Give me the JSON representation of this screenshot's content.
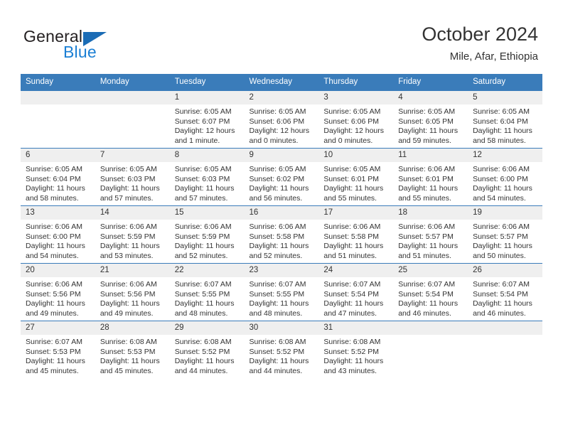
{
  "brand": {
    "name_dark": "General",
    "name_blue": "Blue",
    "accent_blue": "#1b7fd4",
    "header_blue": "#3a7cba"
  },
  "header": {
    "title": "October 2024",
    "subtitle": "Mile, Afar, Ethiopia"
  },
  "weekday_headers": [
    "Sunday",
    "Monday",
    "Tuesday",
    "Wednesday",
    "Thursday",
    "Friday",
    "Saturday"
  ],
  "labels": {
    "sunrise": "Sunrise:",
    "sunset": "Sunset:",
    "daylight": "Daylight:"
  },
  "weeks": [
    [
      {
        "day": "",
        "sunrise": "",
        "sunset": "",
        "daylight_1": "",
        "daylight_2": ""
      },
      {
        "day": "",
        "sunrise": "",
        "sunset": "",
        "daylight_1": "",
        "daylight_2": ""
      },
      {
        "day": "1",
        "sunrise": "Sunrise: 6:05 AM",
        "sunset": "Sunset: 6:07 PM",
        "daylight_1": "Daylight: 12 hours",
        "daylight_2": "and 1 minute."
      },
      {
        "day": "2",
        "sunrise": "Sunrise: 6:05 AM",
        "sunset": "Sunset: 6:06 PM",
        "daylight_1": "Daylight: 12 hours",
        "daylight_2": "and 0 minutes."
      },
      {
        "day": "3",
        "sunrise": "Sunrise: 6:05 AM",
        "sunset": "Sunset: 6:06 PM",
        "daylight_1": "Daylight: 12 hours",
        "daylight_2": "and 0 minutes."
      },
      {
        "day": "4",
        "sunrise": "Sunrise: 6:05 AM",
        "sunset": "Sunset: 6:05 PM",
        "daylight_1": "Daylight: 11 hours",
        "daylight_2": "and 59 minutes."
      },
      {
        "day": "5",
        "sunrise": "Sunrise: 6:05 AM",
        "sunset": "Sunset: 6:04 PM",
        "daylight_1": "Daylight: 11 hours",
        "daylight_2": "and 58 minutes."
      }
    ],
    [
      {
        "day": "6",
        "sunrise": "Sunrise: 6:05 AM",
        "sunset": "Sunset: 6:04 PM",
        "daylight_1": "Daylight: 11 hours",
        "daylight_2": "and 58 minutes."
      },
      {
        "day": "7",
        "sunrise": "Sunrise: 6:05 AM",
        "sunset": "Sunset: 6:03 PM",
        "daylight_1": "Daylight: 11 hours",
        "daylight_2": "and 57 minutes."
      },
      {
        "day": "8",
        "sunrise": "Sunrise: 6:05 AM",
        "sunset": "Sunset: 6:03 PM",
        "daylight_1": "Daylight: 11 hours",
        "daylight_2": "and 57 minutes."
      },
      {
        "day": "9",
        "sunrise": "Sunrise: 6:05 AM",
        "sunset": "Sunset: 6:02 PM",
        "daylight_1": "Daylight: 11 hours",
        "daylight_2": "and 56 minutes."
      },
      {
        "day": "10",
        "sunrise": "Sunrise: 6:05 AM",
        "sunset": "Sunset: 6:01 PM",
        "daylight_1": "Daylight: 11 hours",
        "daylight_2": "and 55 minutes."
      },
      {
        "day": "11",
        "sunrise": "Sunrise: 6:06 AM",
        "sunset": "Sunset: 6:01 PM",
        "daylight_1": "Daylight: 11 hours",
        "daylight_2": "and 55 minutes."
      },
      {
        "day": "12",
        "sunrise": "Sunrise: 6:06 AM",
        "sunset": "Sunset: 6:00 PM",
        "daylight_1": "Daylight: 11 hours",
        "daylight_2": "and 54 minutes."
      }
    ],
    [
      {
        "day": "13",
        "sunrise": "Sunrise: 6:06 AM",
        "sunset": "Sunset: 6:00 PM",
        "daylight_1": "Daylight: 11 hours",
        "daylight_2": "and 54 minutes."
      },
      {
        "day": "14",
        "sunrise": "Sunrise: 6:06 AM",
        "sunset": "Sunset: 5:59 PM",
        "daylight_1": "Daylight: 11 hours",
        "daylight_2": "and 53 minutes."
      },
      {
        "day": "15",
        "sunrise": "Sunrise: 6:06 AM",
        "sunset": "Sunset: 5:59 PM",
        "daylight_1": "Daylight: 11 hours",
        "daylight_2": "and 52 minutes."
      },
      {
        "day": "16",
        "sunrise": "Sunrise: 6:06 AM",
        "sunset": "Sunset: 5:58 PM",
        "daylight_1": "Daylight: 11 hours",
        "daylight_2": "and 52 minutes."
      },
      {
        "day": "17",
        "sunrise": "Sunrise: 6:06 AM",
        "sunset": "Sunset: 5:58 PM",
        "daylight_1": "Daylight: 11 hours",
        "daylight_2": "and 51 minutes."
      },
      {
        "day": "18",
        "sunrise": "Sunrise: 6:06 AM",
        "sunset": "Sunset: 5:57 PM",
        "daylight_1": "Daylight: 11 hours",
        "daylight_2": "and 51 minutes."
      },
      {
        "day": "19",
        "sunrise": "Sunrise: 6:06 AM",
        "sunset": "Sunset: 5:57 PM",
        "daylight_1": "Daylight: 11 hours",
        "daylight_2": "and 50 minutes."
      }
    ],
    [
      {
        "day": "20",
        "sunrise": "Sunrise: 6:06 AM",
        "sunset": "Sunset: 5:56 PM",
        "daylight_1": "Daylight: 11 hours",
        "daylight_2": "and 49 minutes."
      },
      {
        "day": "21",
        "sunrise": "Sunrise: 6:06 AM",
        "sunset": "Sunset: 5:56 PM",
        "daylight_1": "Daylight: 11 hours",
        "daylight_2": "and 49 minutes."
      },
      {
        "day": "22",
        "sunrise": "Sunrise: 6:07 AM",
        "sunset": "Sunset: 5:55 PM",
        "daylight_1": "Daylight: 11 hours",
        "daylight_2": "and 48 minutes."
      },
      {
        "day": "23",
        "sunrise": "Sunrise: 6:07 AM",
        "sunset": "Sunset: 5:55 PM",
        "daylight_1": "Daylight: 11 hours",
        "daylight_2": "and 48 minutes."
      },
      {
        "day": "24",
        "sunrise": "Sunrise: 6:07 AM",
        "sunset": "Sunset: 5:54 PM",
        "daylight_1": "Daylight: 11 hours",
        "daylight_2": "and 47 minutes."
      },
      {
        "day": "25",
        "sunrise": "Sunrise: 6:07 AM",
        "sunset": "Sunset: 5:54 PM",
        "daylight_1": "Daylight: 11 hours",
        "daylight_2": "and 46 minutes."
      },
      {
        "day": "26",
        "sunrise": "Sunrise: 6:07 AM",
        "sunset": "Sunset: 5:54 PM",
        "daylight_1": "Daylight: 11 hours",
        "daylight_2": "and 46 minutes."
      }
    ],
    [
      {
        "day": "27",
        "sunrise": "Sunrise: 6:07 AM",
        "sunset": "Sunset: 5:53 PM",
        "daylight_1": "Daylight: 11 hours",
        "daylight_2": "and 45 minutes."
      },
      {
        "day": "28",
        "sunrise": "Sunrise: 6:08 AM",
        "sunset": "Sunset: 5:53 PM",
        "daylight_1": "Daylight: 11 hours",
        "daylight_2": "and 45 minutes."
      },
      {
        "day": "29",
        "sunrise": "Sunrise: 6:08 AM",
        "sunset": "Sunset: 5:52 PM",
        "daylight_1": "Daylight: 11 hours",
        "daylight_2": "and 44 minutes."
      },
      {
        "day": "30",
        "sunrise": "Sunrise: 6:08 AM",
        "sunset": "Sunset: 5:52 PM",
        "daylight_1": "Daylight: 11 hours",
        "daylight_2": "and 44 minutes."
      },
      {
        "day": "31",
        "sunrise": "Sunrise: 6:08 AM",
        "sunset": "Sunset: 5:52 PM",
        "daylight_1": "Daylight: 11 hours",
        "daylight_2": "and 43 minutes."
      },
      {
        "day": "",
        "sunrise": "",
        "sunset": "",
        "daylight_1": "",
        "daylight_2": ""
      },
      {
        "day": "",
        "sunrise": "",
        "sunset": "",
        "daylight_1": "",
        "daylight_2": ""
      }
    ]
  ]
}
